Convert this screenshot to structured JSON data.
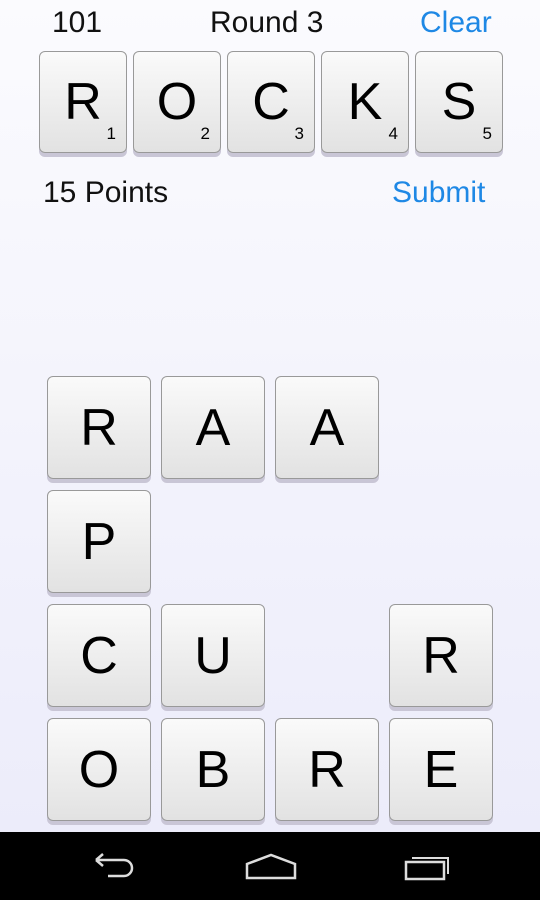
{
  "header": {
    "score": "101",
    "round": "Round 3",
    "clear_label": "Clear"
  },
  "word": {
    "tiles": [
      {
        "letter": "R",
        "score": "1"
      },
      {
        "letter": "O",
        "score": "2"
      },
      {
        "letter": "C",
        "score": "3"
      },
      {
        "letter": "K",
        "score": "4"
      },
      {
        "letter": "S",
        "score": "5"
      }
    ],
    "points": "15 Points",
    "submit_label": "Submit"
  },
  "board": {
    "rows": [
      [
        "R",
        "A",
        "A",
        null
      ],
      [
        "P",
        null,
        null,
        null
      ],
      [
        "C",
        "U",
        null,
        "R"
      ],
      [
        "O",
        "B",
        "R",
        "E"
      ]
    ]
  },
  "nav": {
    "icons": [
      "back-icon",
      "home-icon",
      "recent-apps-icon"
    ]
  },
  "colors": {
    "accent": "#1e88e5"
  }
}
